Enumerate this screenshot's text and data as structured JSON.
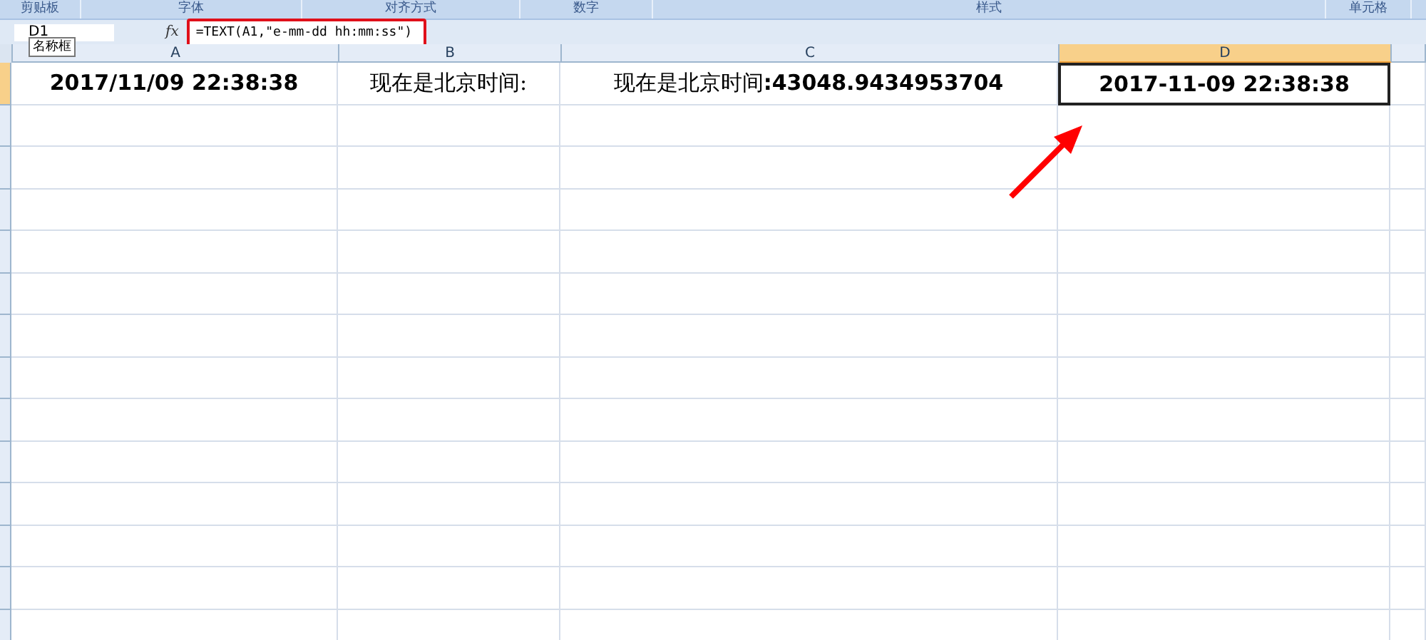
{
  "ribbon_groups": [
    {
      "label": "剪贴板"
    },
    {
      "label": "字体"
    },
    {
      "label": "对齐方式"
    },
    {
      "label": "数字"
    },
    {
      "label": "样式"
    },
    {
      "label": "单元格"
    }
  ],
  "name_box": {
    "value": "D1",
    "tooltip": "名称框"
  },
  "formula_bar": {
    "fx": "fx",
    "value": "=TEXT(A1,\"e-mm-dd hh:mm:ss\")",
    "highlighted": true
  },
  "columns": [
    {
      "label": "A",
      "selected": false
    },
    {
      "label": "B",
      "selected": false
    },
    {
      "label": "C",
      "selected": false
    },
    {
      "label": "D",
      "selected": true
    }
  ],
  "rows": [
    {
      "selected": true,
      "cells": [
        {
          "text": "2017/11/09 22:38:38",
          "bold": true,
          "selected": false
        },
        {
          "text": "现在是北京时间:",
          "bold": false,
          "selected": false
        },
        {
          "text": "现在是北京时间**:43048.9434953704**",
          "bold": false,
          "selected": false
        },
        {
          "text": "2017-11-09 22:38:38",
          "bold": true,
          "selected": true
        }
      ]
    }
  ],
  "arrow": {
    "color": "#ff0000"
  }
}
